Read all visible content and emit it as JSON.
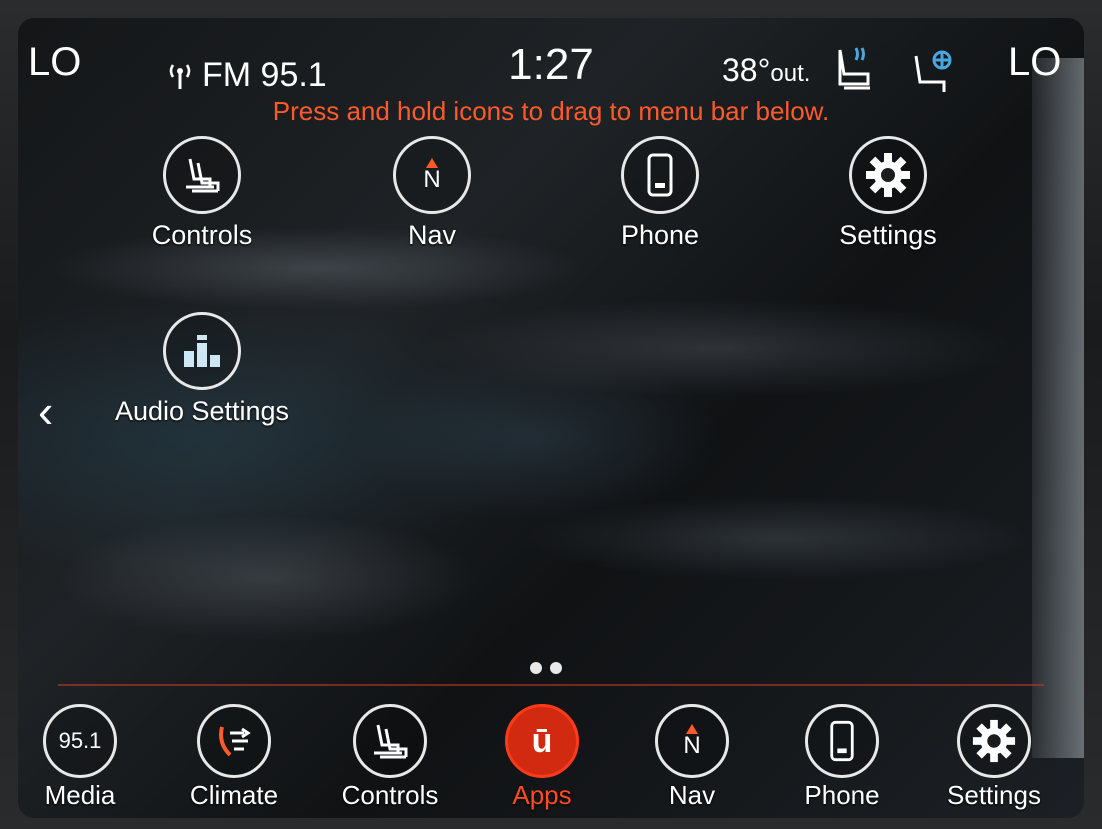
{
  "status": {
    "left_temp": "LO",
    "radio": "FM 95.1",
    "clock": "1:27",
    "outside_temp": "38°",
    "outside_suffix": "out.",
    "right_temp": "LO"
  },
  "hint": "Press and hold icons to drag to menu bar below.",
  "apps": [
    {
      "label": "Controls",
      "icon": "seat-controls-icon"
    },
    {
      "label": "Nav",
      "icon": "compass-icon",
      "glyph": "N"
    },
    {
      "label": "Phone",
      "icon": "phone-icon"
    },
    {
      "label": "Settings",
      "icon": "gear-icon"
    },
    {
      "label": "Audio Settings",
      "icon": "equalizer-icon"
    }
  ],
  "back_glyph": "‹",
  "menu_bar": [
    {
      "label": "Media",
      "icon": "media-icon",
      "glyph": "95.1"
    },
    {
      "label": "Climate",
      "icon": "climate-icon"
    },
    {
      "label": "Controls",
      "icon": "seat-controls-icon"
    },
    {
      "label": "Apps",
      "icon": "apps-icon",
      "glyph": "ū",
      "active": true
    },
    {
      "label": "Nav",
      "icon": "compass-icon",
      "glyph": "N"
    },
    {
      "label": "Phone",
      "icon": "phone-icon"
    },
    {
      "label": "Settings",
      "icon": "gear-icon"
    }
  ],
  "colors": {
    "accent": "#ff5a2a",
    "apps_active": "#d22a10",
    "text": "#ffffff"
  }
}
